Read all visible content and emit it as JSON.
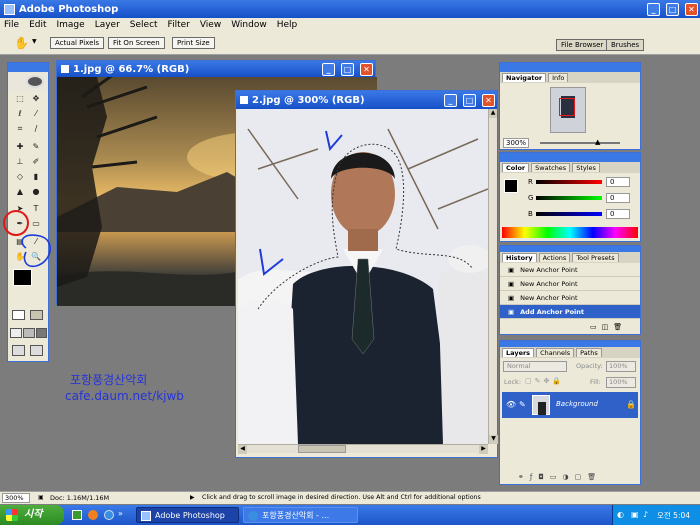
{
  "app": {
    "title": "Adobe Photoshop"
  },
  "menu": [
    "File",
    "Edit",
    "Image",
    "Layer",
    "Select",
    "Filter",
    "View",
    "Window",
    "Help"
  ],
  "options": {
    "actual_pixels": "Actual Pixels",
    "fit_on_screen": "Fit On Screen",
    "print_size": "Print Size"
  },
  "palette_well": {
    "file_browser": "File Browser",
    "brushes": "Brushes"
  },
  "doc1": {
    "title": "1.jpg @ 66.7% (RGB)"
  },
  "doc2": {
    "title": "2.jpg @ 300% (RGB)"
  },
  "navigator": {
    "tabs": [
      "Navigator",
      "Info"
    ],
    "zoom": "300%"
  },
  "color": {
    "tabs": [
      "Color",
      "Swatches",
      "Styles"
    ],
    "channels": [
      {
        "label": "R",
        "value": "0"
      },
      {
        "label": "G",
        "value": "0"
      },
      {
        "label": "B",
        "value": "0"
      }
    ]
  },
  "history": {
    "tabs": [
      "History",
      "Actions",
      "Tool Presets"
    ],
    "items": [
      "New Anchor Point",
      "New Anchor Point",
      "New Anchor Point",
      "Add Anchor Point"
    ]
  },
  "layers": {
    "tabs": [
      "Layers",
      "Channels",
      "Paths"
    ],
    "blend": "Normal",
    "opacity_label": "Opacity:",
    "opacity": "100%",
    "fill_label": "Fill:",
    "fill": "100%",
    "lock_label": "Lock:",
    "layer_name": "Background"
  },
  "watermark": {
    "line1": "포항풍경산악회",
    "line2": "cafe.daum.net/kjwb"
  },
  "status": {
    "zoom": "300%",
    "doc": "Doc: 1.16M/1.16M",
    "hint": "Click and drag to scroll image in desired direction. Use Alt and Ctrl for additional options"
  },
  "taskbar": {
    "start": "시작",
    "task1": "Adobe Photoshop",
    "task2": "포항풍경산악회 - ...",
    "time": "오전 5:04"
  },
  "colors": {
    "title": "#2157d6",
    "panel": "#ece9d8",
    "selection": "#2f61c9",
    "annotation_red": "#e01818",
    "annotation_blue": "#1e3cd8"
  }
}
